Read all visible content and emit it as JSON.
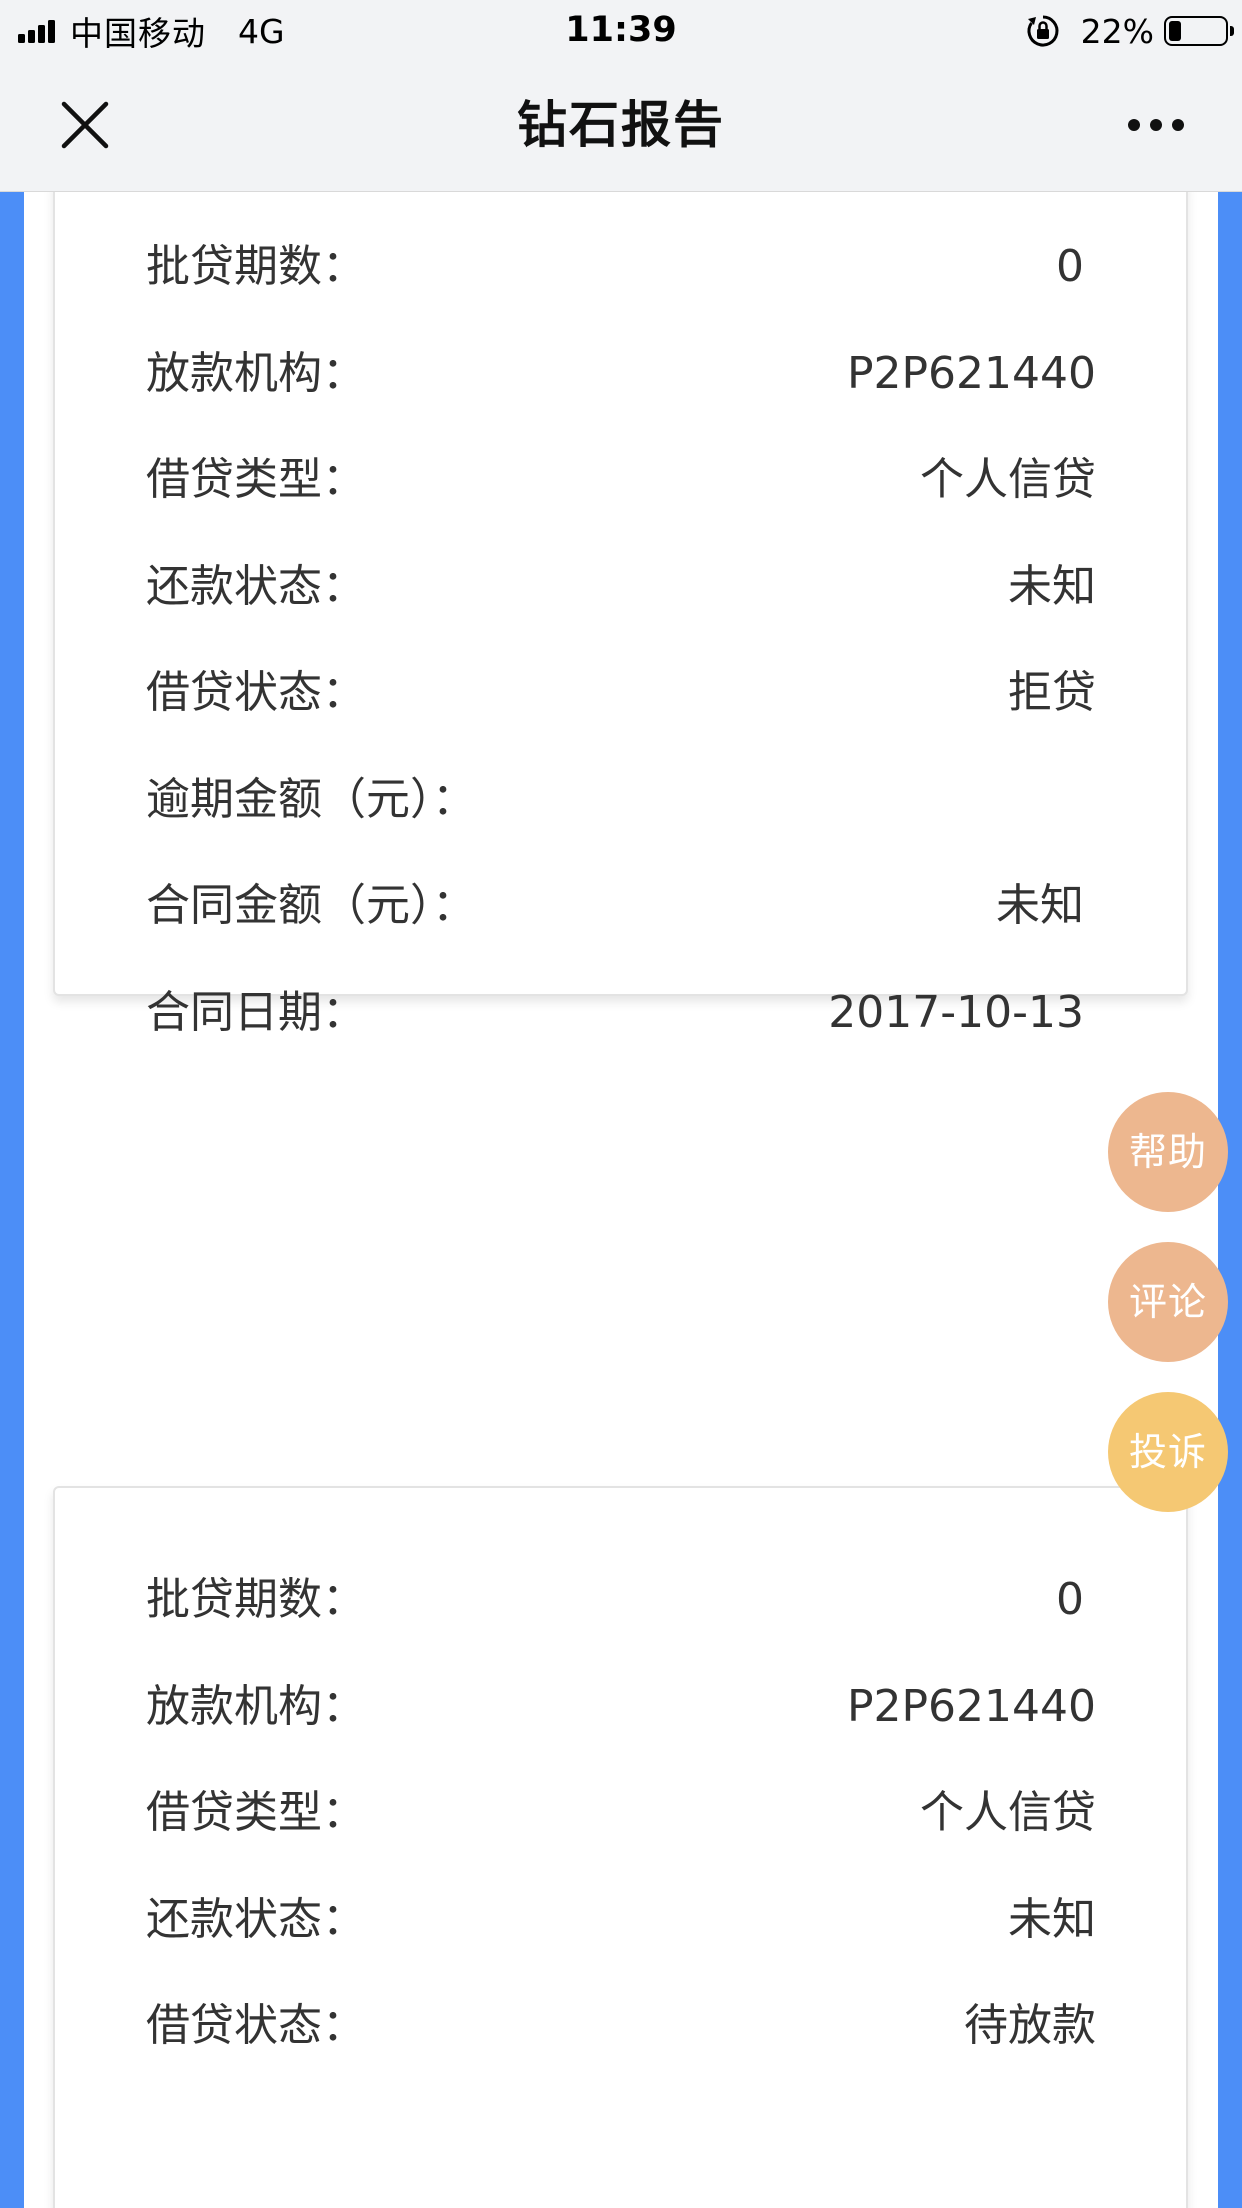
{
  "status_bar": {
    "carrier": "中国移动",
    "network": "4G",
    "time": "11:39",
    "battery_percent": "22%",
    "battery_level": 0.22
  },
  "nav": {
    "title": "钻石报告",
    "close_icon": "close-icon",
    "more_icon": "more-dots-icon"
  },
  "colors": {
    "border_blue": "#4c8ef7",
    "help_button": "#edb78f",
    "comment_button": "#edb78f",
    "complaint_button": "#f5c873",
    "nav_background": "#f2f3f5"
  },
  "cards": [
    {
      "rows": [
        {
          "label": "批贷期数：",
          "value": "0"
        },
        {
          "label": "放款机构：",
          "value": "P2P621440"
        },
        {
          "label": "借贷类型：",
          "value": "个人信贷"
        },
        {
          "label": "还款状态：",
          "value": "未知"
        },
        {
          "label": "借贷状态：",
          "value": "拒贷"
        },
        {
          "label": "逾期金额（元）：",
          "value": ""
        },
        {
          "label": "合同金额（元）：",
          "value": "未知"
        },
        {
          "label": "合同日期：",
          "value": "2017-10-13"
        }
      ]
    },
    {
      "rows": [
        {
          "label": "批贷期数：",
          "value": "0"
        },
        {
          "label": "放款机构：",
          "value": "P2P621440"
        },
        {
          "label": "借贷类型：",
          "value": "个人信贷"
        },
        {
          "label": "还款状态：",
          "value": "未知"
        },
        {
          "label": "借贷状态：",
          "value": "待放款"
        }
      ]
    }
  ],
  "floating_buttons": {
    "help": "帮助",
    "comment": "评论",
    "complaint": "投诉"
  }
}
